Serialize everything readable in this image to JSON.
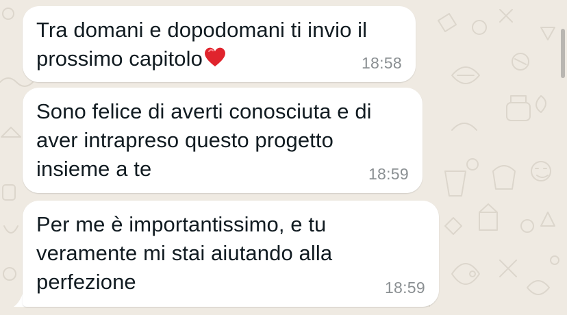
{
  "chat": {
    "messages": [
      {
        "text": "Tra domani e dopodomani ti invio il\nprossimo capitolo",
        "emoji": "red-heart",
        "time": "18:58"
      },
      {
        "text": "Sono felice di averti conosciuta e di\naver intrapreso questo progetto\ninsieme a te",
        "time": "18:59"
      },
      {
        "text": "Per me è importantissimo, e tu\nveramente mi stai aiutando alla\nperfezione",
        "time": "18:59"
      }
    ]
  },
  "colors": {
    "wallpaper": "#efeae2",
    "bubble": "#ffffff",
    "text": "#111b21",
    "timestamp": "#8a8f92",
    "heart": "#e0242d"
  }
}
